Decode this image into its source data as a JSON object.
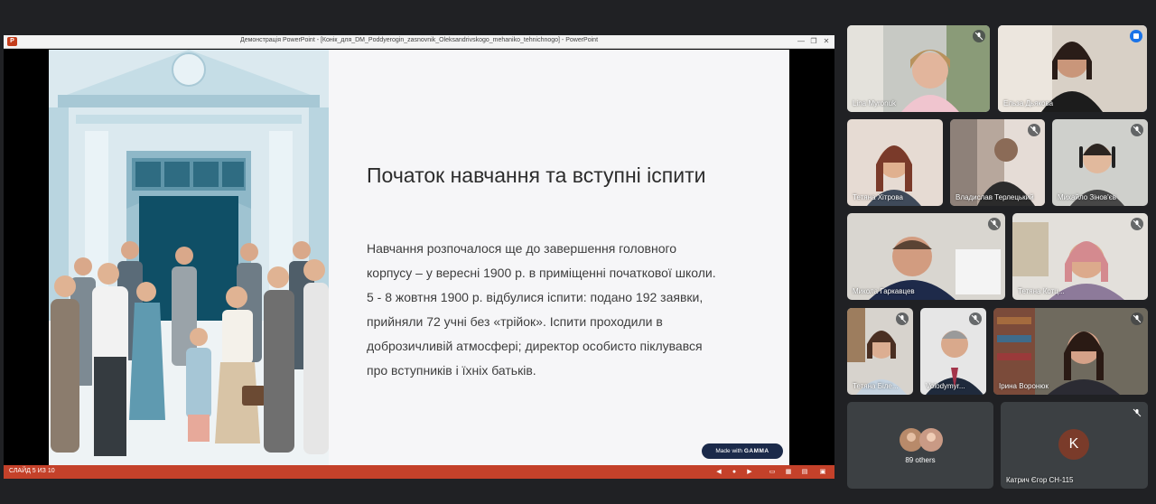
{
  "ppt": {
    "window_title": "Демонстрація PowerPoint - [Конік_для_DM_Poddyerogin_zasnovnik_Oleksandrivskogo_mehaniko_tehnichnogo] - PowerPoint",
    "status_slide": "СЛАЙД 5 ИЗ 10"
  },
  "slide": {
    "heading": "Початок навчання та вступні іспити",
    "body_lines": [
      "Навчання розпочалося ще до завершення головного",
      "корпусу – у вересні 1900 р. в приміщенні початкової школи.",
      "5 - 8 жовтня 1900 р. відбулися іспити: подано 192 заявки,",
      "прийняли 72 учні без «трійок». Іспити проходили в",
      "доброзичливій атмосфері; директор особисто піклувався",
      "про вступників і їхніх батьків."
    ],
    "badge_prefix": "Made with",
    "badge_brand": "GAMMA"
  },
  "participants": [
    {
      "name": "Lina Myronuk",
      "muted": true
    },
    {
      "name": "Ельза Дьякова",
      "muted": false,
      "speaking": true
    },
    {
      "name": "Тетяна Хітрова",
      "muted": false
    },
    {
      "name": "Владислав Терлецький",
      "muted": true
    },
    {
      "name": "Михайло Зінов'єв",
      "muted": true
    },
    {
      "name": "Микола Гаркавцев",
      "muted": true
    },
    {
      "name": "Тетяна Котц...",
      "muted": true
    },
    {
      "name": "Тетяна Біле...",
      "muted": true
    },
    {
      "name": "Volodymyr...",
      "muted": true
    },
    {
      "name": "Ірина Воронюк",
      "muted": true
    }
  ],
  "others": {
    "label": "89 others"
  },
  "last_tile": {
    "initial": "K",
    "name": "Катрич Єгор СН-115",
    "muted": true
  },
  "colors": {
    "meet_bg": "#202124",
    "tile_bg": "#3c4043",
    "ppt_status": "#c4412a",
    "speaking": "#1a73e8"
  }
}
